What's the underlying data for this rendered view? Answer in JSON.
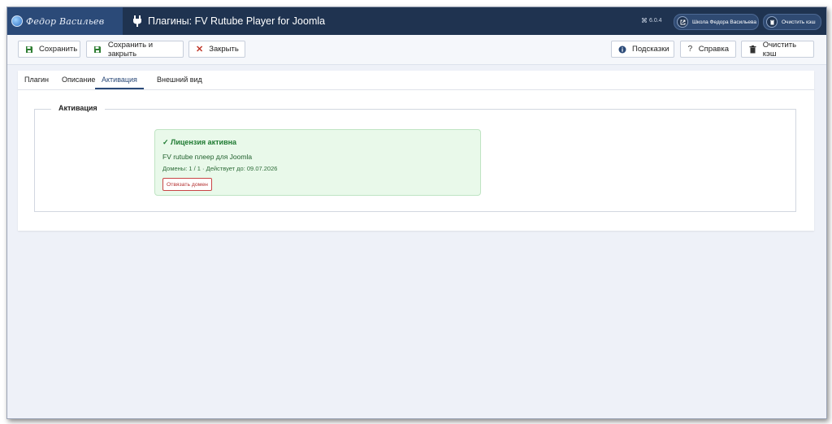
{
  "header": {
    "logo_text": "Федор Васильев",
    "title": "Плагины: FV Rutube Player for Joomla",
    "version": "6.0.4",
    "site_button": "Школа Федора Васильева",
    "clear_cache_button": "Очистить кэш"
  },
  "toolbar": {
    "save": "Сохранить",
    "save_close": "Сохранить и закрыть",
    "close": "Закрыть",
    "hints": "Подсказки",
    "help": "Справка",
    "clear_cache": "Очистить кэш"
  },
  "tabs": [
    {
      "label": "Плагин"
    },
    {
      "label": "Описание"
    },
    {
      "label": "Активация",
      "active": true
    },
    {
      "label": "Внешний вид"
    }
  ],
  "activation": {
    "legend": "Активация",
    "status": "✓ Лицензия активна",
    "product": "FV rutube плеер для Joomla",
    "meta": "Домены: 1 / 1 · Действует до: 09.07.2026",
    "unbind_button": "Отвязать домен"
  },
  "colors": {
    "header_bg": "#1f3350",
    "accent": "#2b4a78",
    "success_bg": "#e9f9ea",
    "success_text": "#1f7a32",
    "danger": "#b43131"
  }
}
